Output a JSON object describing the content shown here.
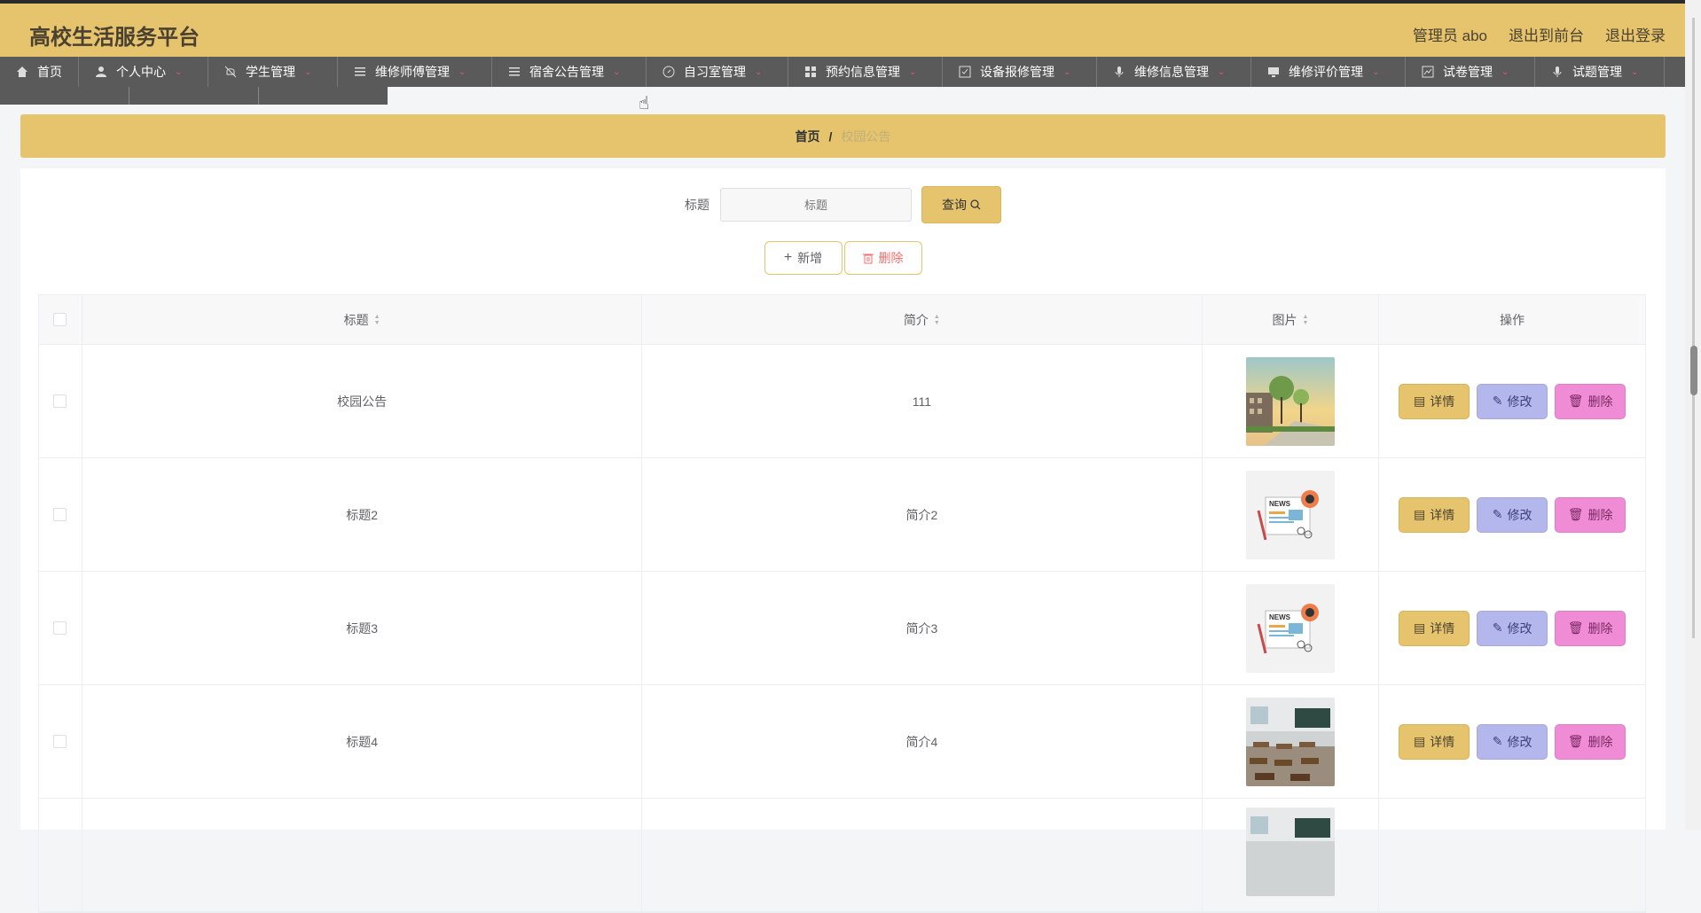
{
  "header": {
    "app_title": "高校生活服务平台",
    "admin_label": "管理员 abo",
    "to_front_label": "退出到前台",
    "logout_label": "退出登录"
  },
  "nav": {
    "items": [
      {
        "label": "首页",
        "icon": "home-icon",
        "has_caret": false
      },
      {
        "label": "个人中心",
        "icon": "user-icon",
        "has_caret": true
      },
      {
        "label": "学生管理",
        "icon": "bell-off-icon",
        "has_caret": true
      },
      {
        "label": "维修师傅管理",
        "icon": "menu-icon",
        "has_caret": true
      },
      {
        "label": "宿舍公告管理",
        "icon": "menu-icon",
        "has_caret": true
      },
      {
        "label": "自习室管理",
        "icon": "compass-icon",
        "has_caret": true
      },
      {
        "label": "预约信息管理",
        "icon": "grid-icon",
        "has_caret": true
      },
      {
        "label": "设备报修管理",
        "icon": "checklist-icon",
        "has_caret": true
      },
      {
        "label": "维修信息管理",
        "icon": "microphone-icon",
        "has_caret": true
      },
      {
        "label": "维修评价管理",
        "icon": "monitor-icon",
        "has_caret": true
      },
      {
        "label": "试卷管理",
        "icon": "chart-icon",
        "has_caret": true
      },
      {
        "label": "试题管理",
        "icon": "microphone-icon",
        "has_caret": true
      }
    ]
  },
  "breadcrumb": {
    "home": "首页",
    "separator": "/",
    "current": "校园公告"
  },
  "search": {
    "label": "标题",
    "placeholder": "标题",
    "button_label": "查询"
  },
  "actions": {
    "add_label": "新增",
    "delete_label": "删除"
  },
  "table": {
    "headers": {
      "title": "标题",
      "intro": "简介",
      "image": "图片",
      "ops": "操作"
    },
    "op_labels": {
      "detail": "详情",
      "edit": "修改",
      "delete": "删除"
    },
    "rows": [
      {
        "title": "校园公告",
        "intro": "111",
        "image": "campus-street-photo"
      },
      {
        "title": "标题2",
        "intro": "简介2",
        "image": "news-illustration"
      },
      {
        "title": "标题3",
        "intro": "简介3",
        "image": "news-illustration"
      },
      {
        "title": "标题4",
        "intro": "简介4",
        "image": "classroom-photo"
      },
      {
        "title": "",
        "intro": "",
        "image": "classroom-photo"
      }
    ]
  },
  "colors": {
    "accent": "#e6c46d",
    "nav_bg": "#5a5a5a",
    "edit_btn": "#b4b7ec",
    "delete_btn": "#f08bd6"
  }
}
